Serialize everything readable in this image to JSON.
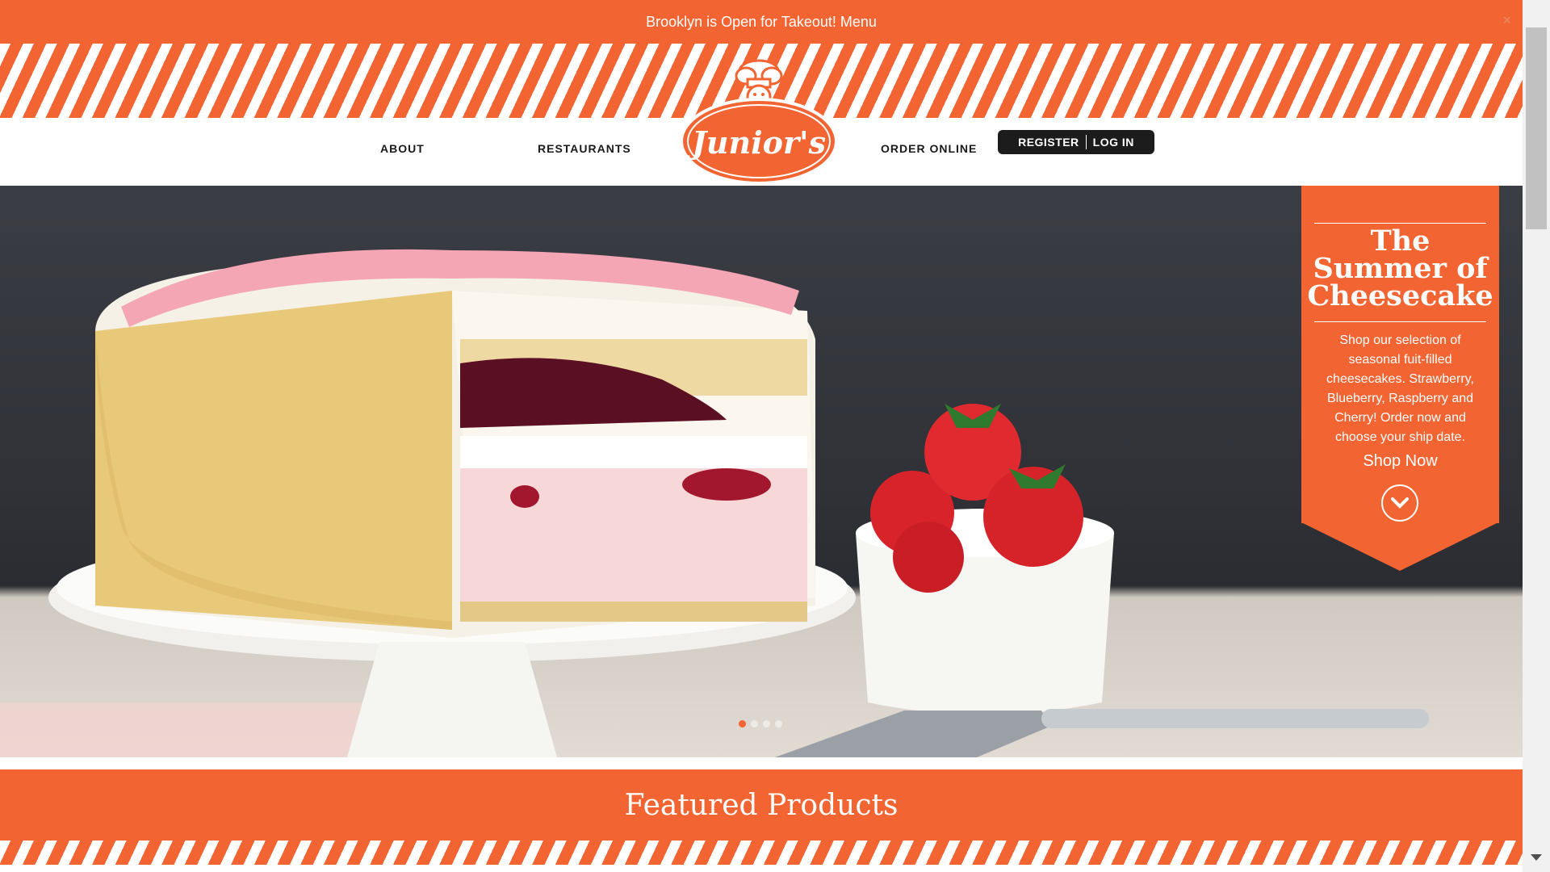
{
  "announcement": {
    "text": "Brooklyn is Open for Takeout! Menu",
    "close_label": "×"
  },
  "nav": {
    "about": "ABOUT",
    "restaurants": "RESTAURANTS",
    "order_online": "ORDER ONLINE",
    "register": "REGISTER",
    "login": "LOG IN"
  },
  "logo": {
    "text": "Junior's"
  },
  "promo": {
    "title_lines": [
      "The",
      "Summer of",
      "Cheesecake"
    ],
    "body": "Shop our selection of seasonal fuit-filled cheesecakes. Strawberry, Blueberry, Raspberry and Cherry! Order now and choose your ship date.",
    "cta": "Shop Now"
  },
  "carousel": {
    "slides": 4,
    "active_index": 0
  },
  "featured": {
    "title": "Featured Products"
  },
  "colors": {
    "brand_orange": "#f26432",
    "dark": "#1c1c1c"
  },
  "icons": [
    "close-icon",
    "chevron-down-icon",
    "chef-logo-icon"
  ]
}
